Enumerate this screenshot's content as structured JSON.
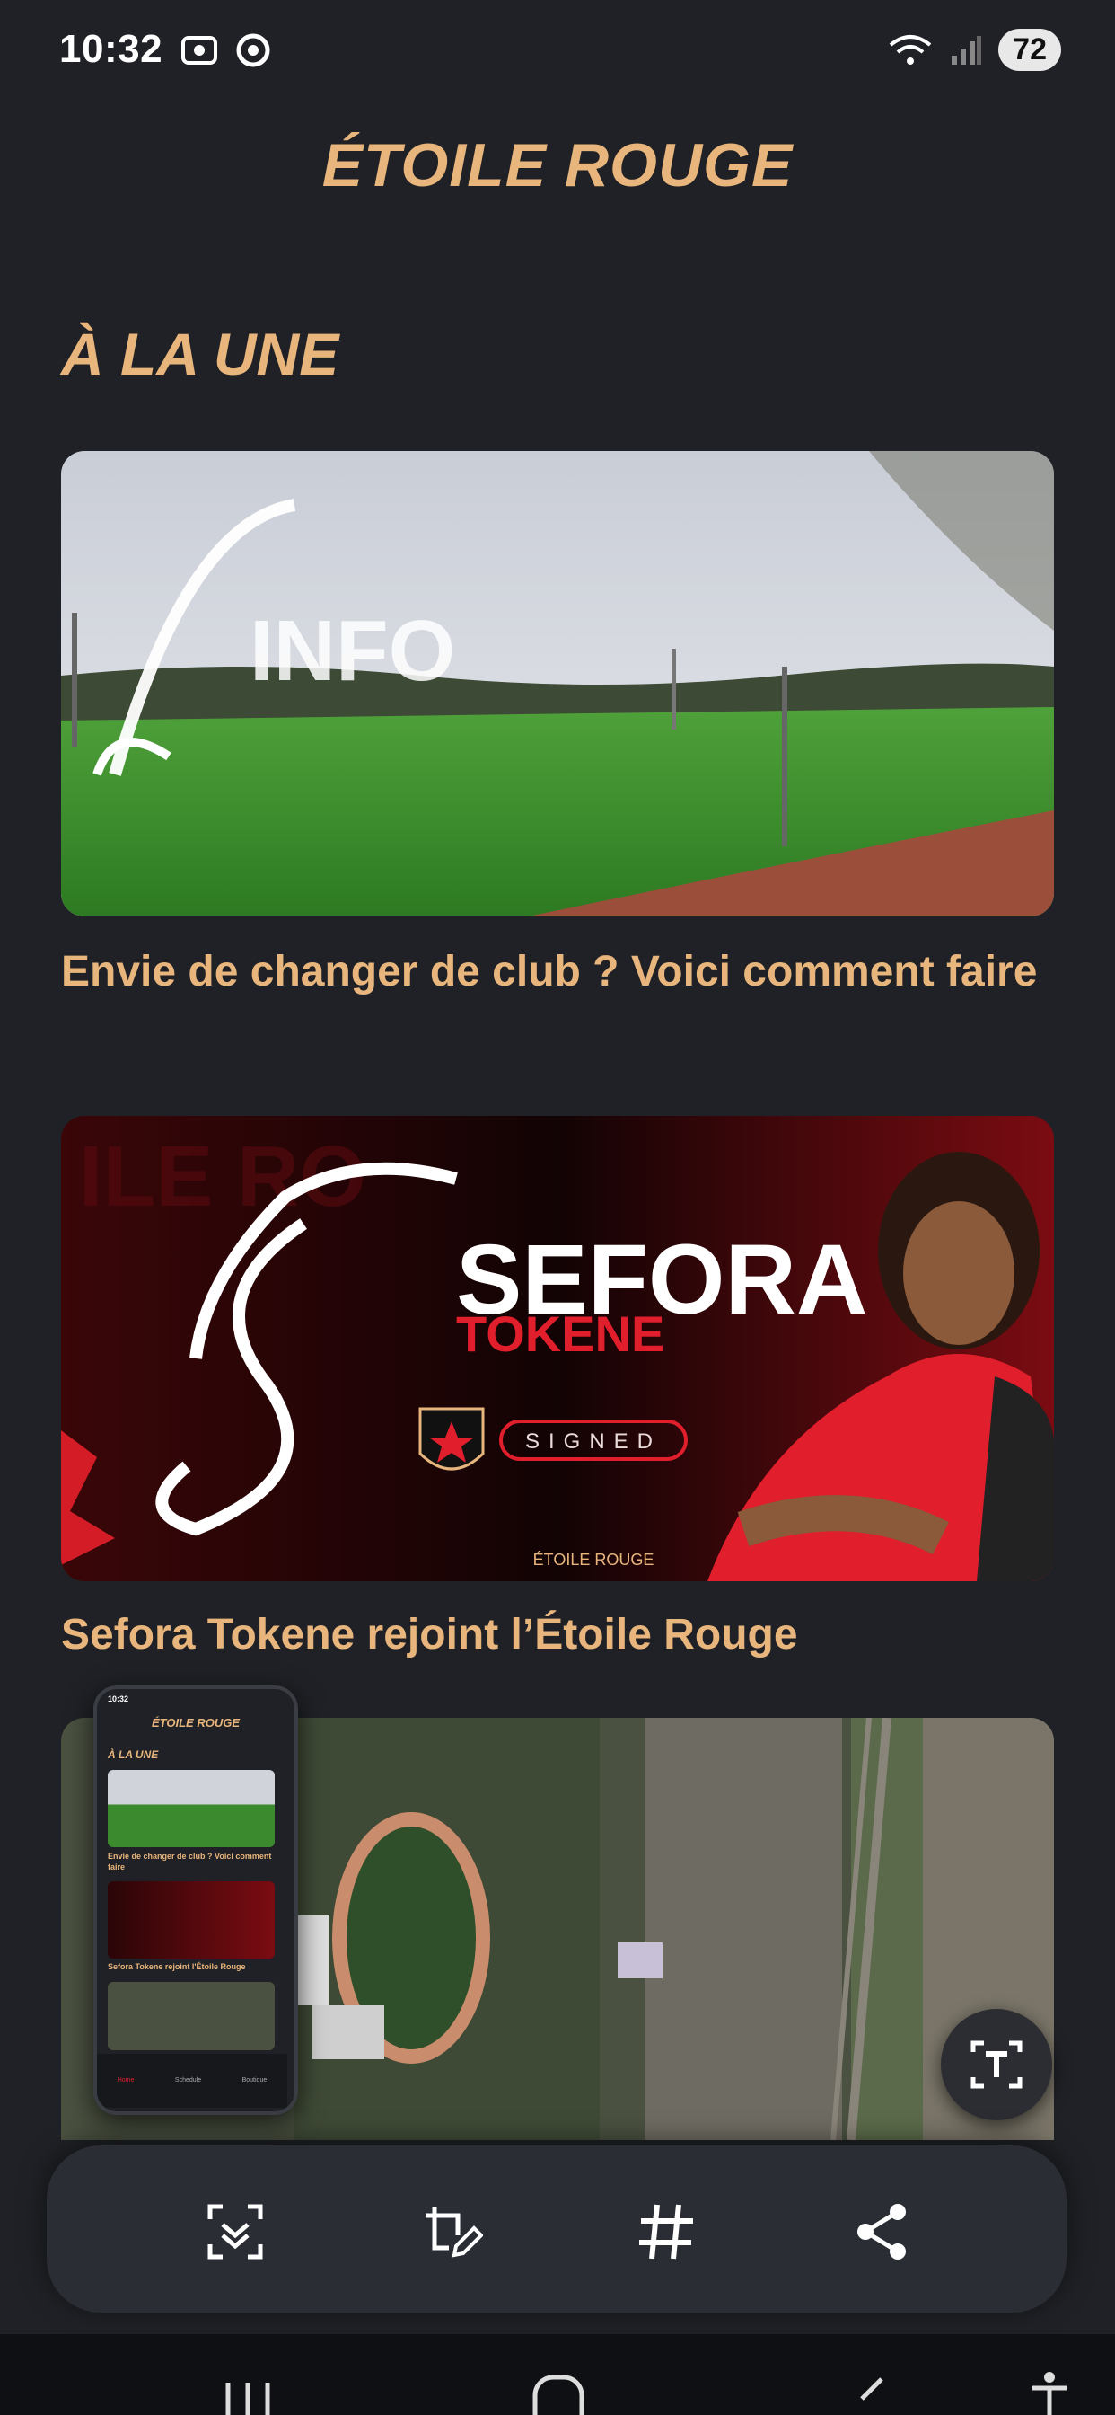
{
  "status_bar": {
    "time": "10:32",
    "battery": "72",
    "left_icons": [
      "screenshot-icon",
      "chrome-icon"
    ],
    "right_icons": [
      "wifi-icon",
      "signal-icon"
    ]
  },
  "app": {
    "title": "ÉTOILE ROUGE"
  },
  "section": {
    "title": "À LA UNE"
  },
  "articles": [
    {
      "title": "Envie de changer de club ? Voici comment faire",
      "image_text": "INFO"
    },
    {
      "title": "Sefora Tokene rejoint l’Étoile Rouge",
      "image_text_main": "SEFORA",
      "image_text_sub": "TOKENE",
      "image_badge": "SIGNED",
      "image_club": "ÉTOILE ROUGE",
      "image_crest": "ÉTOILE ROUGE"
    }
  ],
  "thumbnail": {
    "time": "10:32",
    "app_title": "ÉTOILE ROUGE",
    "section": "À LA UNE",
    "article1": "Envie de changer de club ? Voici comment faire",
    "article2": "Sefora Tokene rejoint l'Étoile Rouge",
    "tabs": [
      "Home",
      "Schedule",
      "Boutique"
    ]
  },
  "toolbar": {
    "items": [
      "scan-select-icon",
      "crop-edit-icon",
      "hashtag-icon",
      "share-icon"
    ]
  },
  "colors": {
    "accent": "#e8b57c",
    "background": "#1f2126",
    "red": "#e01e2c"
  }
}
